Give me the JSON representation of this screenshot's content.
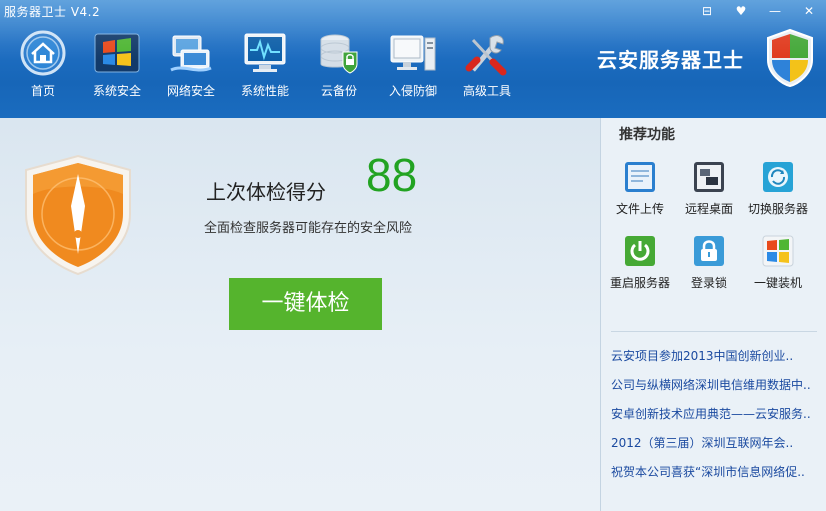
{
  "window": {
    "title": "服务器卫士 V4.2",
    "controls": [
      "⊟",
      "♥",
      "—",
      "✕"
    ]
  },
  "nav": [
    {
      "label": "首页",
      "icon": "home-icon"
    },
    {
      "label": "系统安全",
      "icon": "windows-icon"
    },
    {
      "label": "网络安全",
      "icon": "network-icon"
    },
    {
      "label": "系统性能",
      "icon": "monitor-pulse-icon"
    },
    {
      "label": "云备份",
      "icon": "database-lock-icon"
    },
    {
      "label": "入侵防御",
      "icon": "computer-icon"
    },
    {
      "label": "高级工具",
      "icon": "tools-icon"
    }
  ],
  "brand": {
    "name": "云安服务器卫士"
  },
  "checkup": {
    "score_label": "上次体检得分",
    "score": "88",
    "description": "全面检查服务器可能存在的安全风险",
    "button_label": "一键体检"
  },
  "side": {
    "title": "推荐功能",
    "features": [
      {
        "label": "文件上传",
        "icon": "file-upload-icon"
      },
      {
        "label": "远程桌面",
        "icon": "remote-desktop-icon"
      },
      {
        "label": "切换服务器",
        "icon": "switch-server-icon"
      },
      {
        "label": "重启服务器",
        "icon": "power-icon"
      },
      {
        "label": "登录锁",
        "icon": "lock-icon"
      },
      {
        "label": "一键装机",
        "icon": "windows-install-icon"
      }
    ],
    "news": [
      "云安项目参加2013中国创新创业..",
      "公司与纵横网络深圳电信维用数据中..",
      "安卓创新技术应用典范——云安服务..",
      "2012（第三届）深圳互联网年会..",
      "祝贺本公司喜获“深圳市信息网络促.."
    ]
  },
  "colors": {
    "header": "#1f6fc3",
    "accent_green": "#55b42d",
    "score_green": "#22a322",
    "shield_orange": "#f08a1f",
    "link_blue": "#1b4aa0"
  }
}
